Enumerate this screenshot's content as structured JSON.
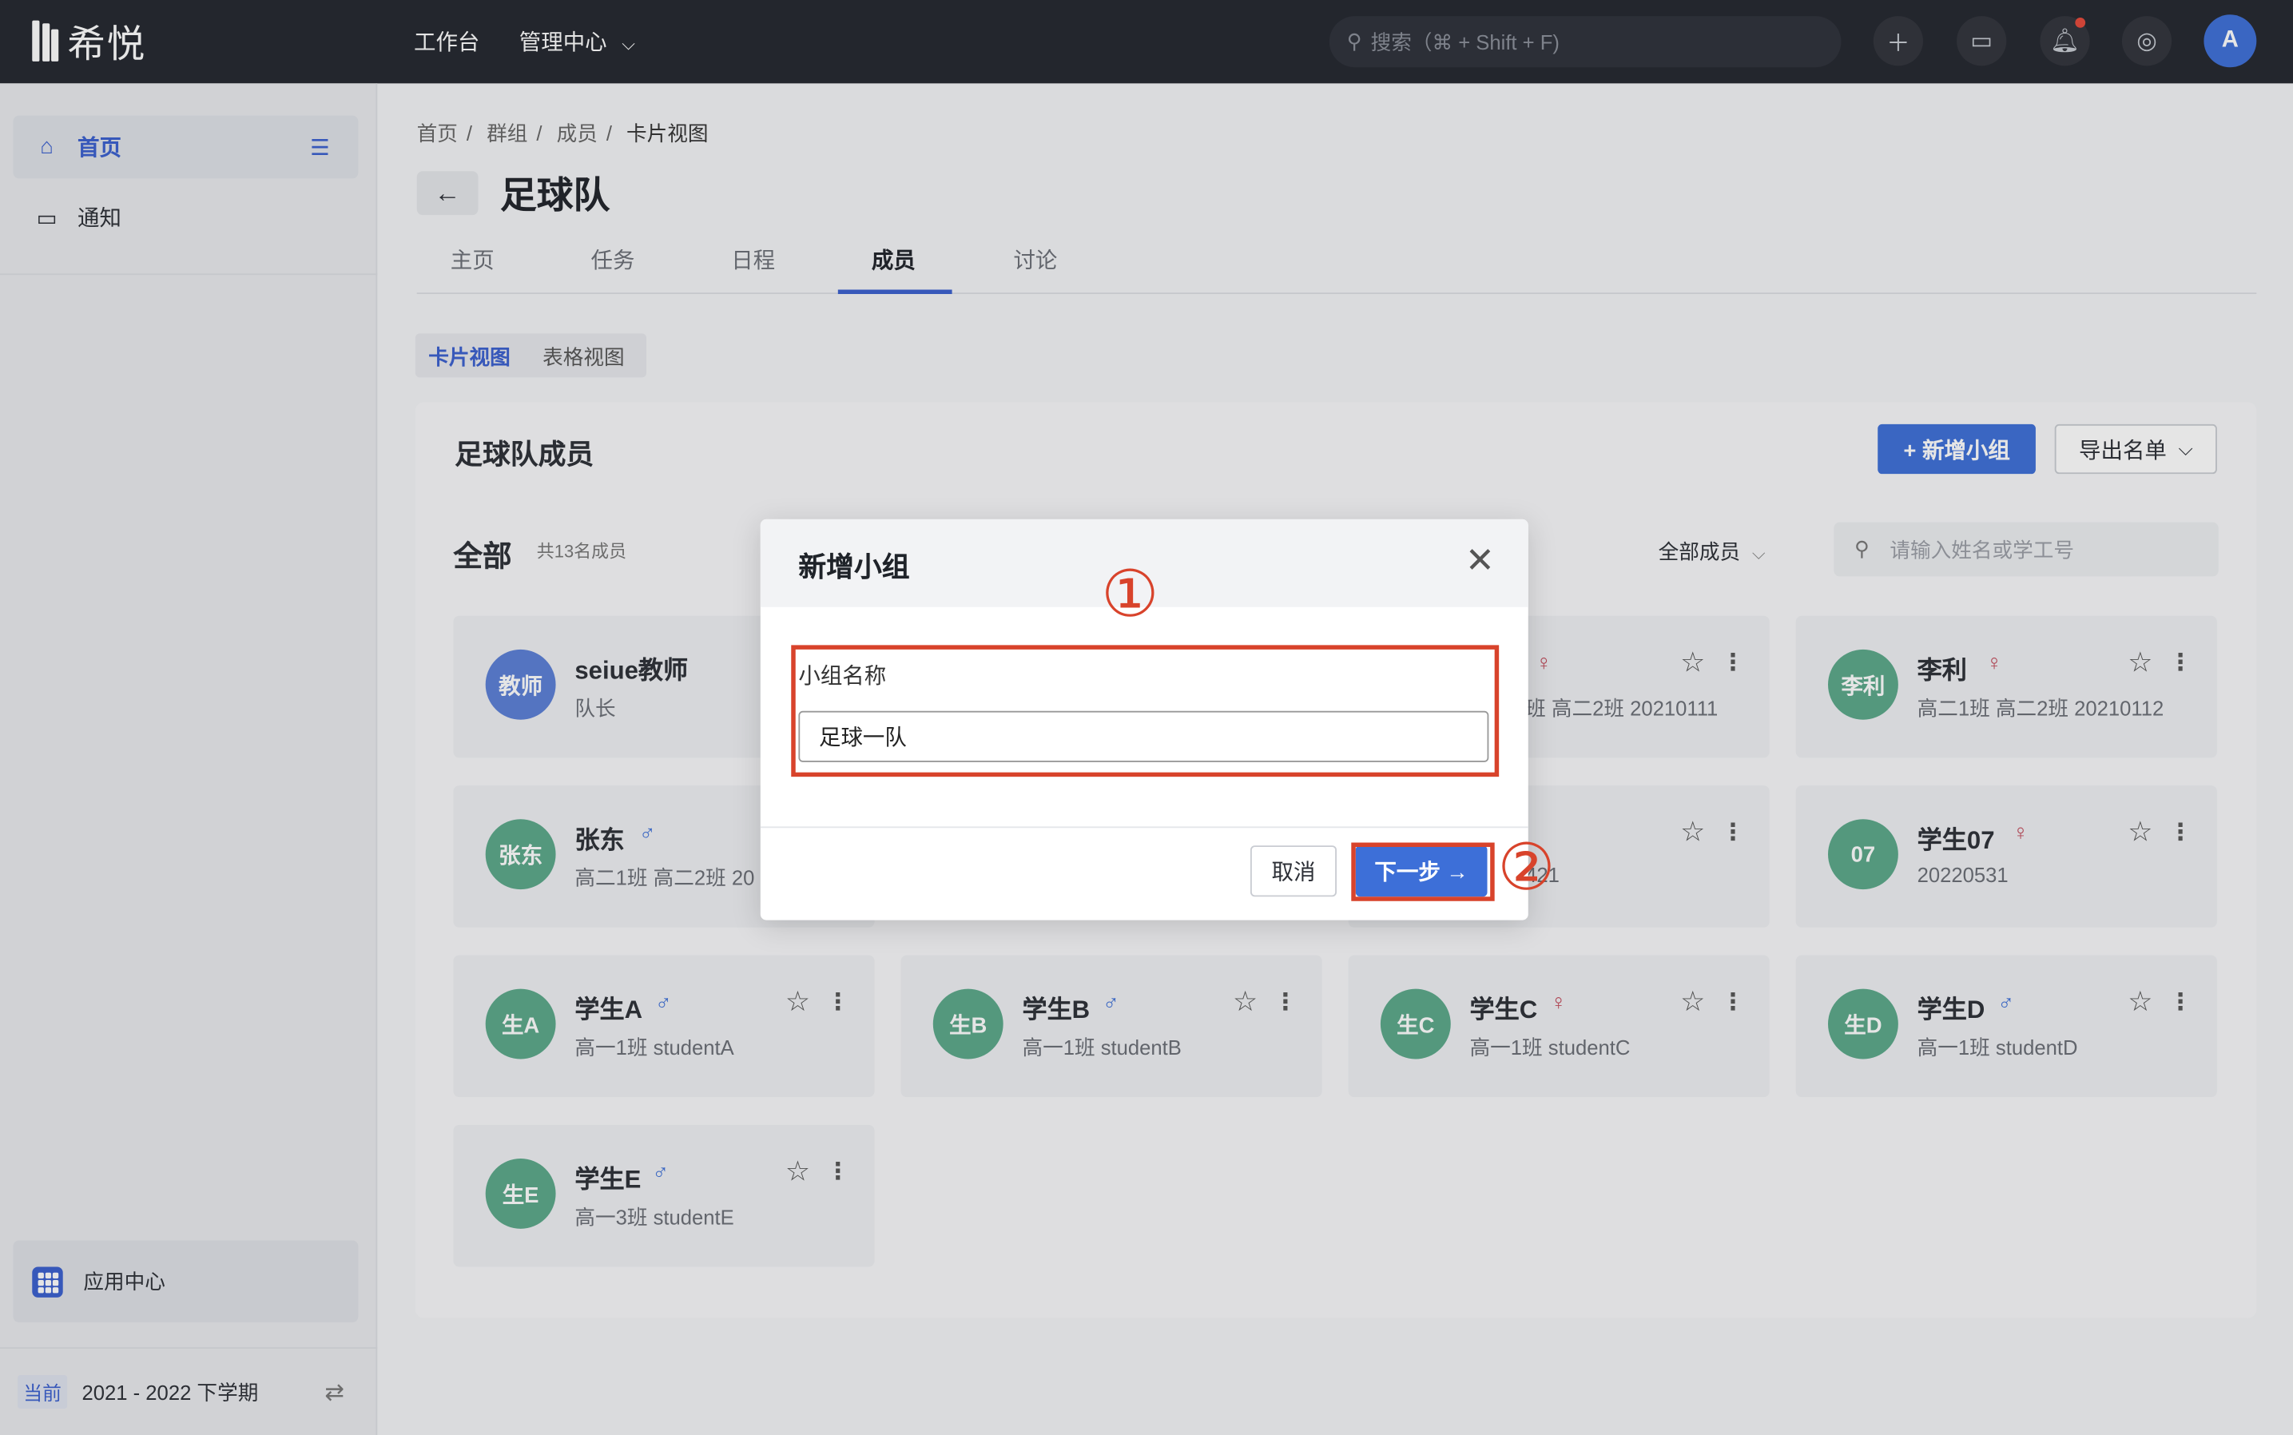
{
  "app": {
    "logo_text": "希悦",
    "nav_workbench": "工作台",
    "nav_admin": "管理中心",
    "search_placeholder": "搜索（⌘ + Shift + F)",
    "avatar_letter": "A"
  },
  "sidebar": {
    "home": "首页",
    "notice": "通知",
    "app_center": "应用中心",
    "term_tag": "当前",
    "term_value": "2021 - 2022 下学期"
  },
  "breadcrumb": [
    "首页",
    "群组",
    "成员",
    "卡片视图"
  ],
  "page": {
    "title": "足球队",
    "tabs": [
      "主页",
      "任务",
      "日程",
      "成员",
      "讨论"
    ],
    "active_tab": "成员",
    "view_card": "卡片视图",
    "view_table": "表格视图"
  },
  "panel": {
    "title": "足球队成员",
    "add_group": "+ 新增小组",
    "export": "导出名单",
    "section": "全部",
    "count": "共13名成员",
    "filter": "全部成员",
    "member_search_placeholder": "请输入姓名或学工号"
  },
  "members": [
    {
      "avatar": "教师",
      "name": "seiue教师",
      "sub": "队长",
      "sex": "",
      "color": "#5b7fd6"
    },
    {
      "avatar": "",
      "name": "",
      "sub": "班 高二2班 20210111",
      "sex": "♀",
      "color": "#5aa889"
    },
    {
      "avatar": "李利",
      "name": "李利",
      "sub": "高二1班 高二2班 20210112",
      "sex": "♀",
      "color": "#5aa889"
    },
    {
      "avatar": "张东",
      "name": "张东",
      "sub": "高二1班 高二2班 20",
      "sex": "♂",
      "color": "#5aa889"
    },
    {
      "avatar": "",
      "name": "",
      "sub": "421",
      "sex": "",
      "color": "#5aa889"
    },
    {
      "avatar": "07",
      "name": "学生07",
      "sub": "20220531",
      "sex": "♀",
      "color": "#5aa889"
    },
    {
      "avatar": "生A",
      "name": "学生A",
      "sub": "高一1班 studentA",
      "sex": "♂",
      "color": "#5aa889"
    },
    {
      "avatar": "生B",
      "name": "学生B",
      "sub": "高一1班 studentB",
      "sex": "♂",
      "color": "#5aa889"
    },
    {
      "avatar": "生C",
      "name": "学生C",
      "sub": "高一1班 studentC",
      "sex": "♀",
      "color": "#5aa889"
    },
    {
      "avatar": "生D",
      "name": "学生D",
      "sub": "高一1班 studentD",
      "sex": "♂",
      "color": "#5aa889"
    },
    {
      "avatar": "生E",
      "name": "学生E",
      "sub": "高一3班 studentE",
      "sex": "♂",
      "color": "#5aa889"
    }
  ],
  "modal": {
    "title": "新增小组",
    "field_label": "小组名称",
    "field_value": "足球一队",
    "cancel": "取消",
    "next": "下一步 →"
  },
  "annotations": {
    "step1": "①",
    "step2": "②",
    "color": "#d8432b"
  }
}
